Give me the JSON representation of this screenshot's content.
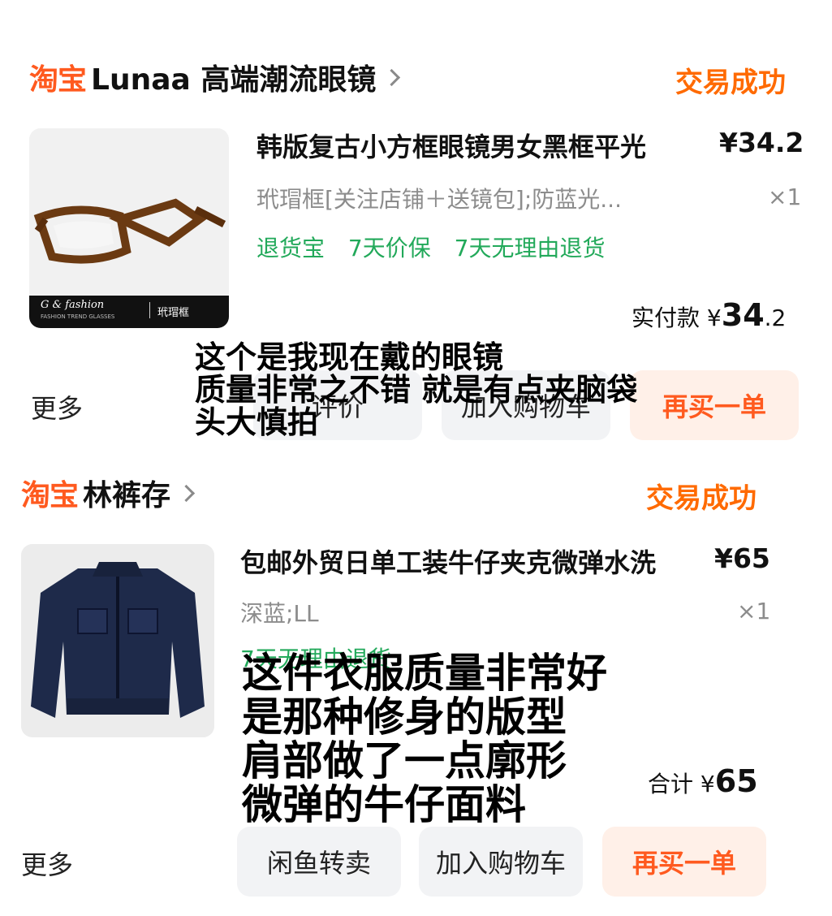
{
  "brand": {
    "logo_text": "淘宝",
    "accent_color": "#ff5a1f",
    "status_color": "#ff6a00",
    "tag_color": "#22a95a"
  },
  "orders": [
    {
      "shop_name": "Lunaa 高端潮流眼镜",
      "status": "交易成功",
      "item": {
        "thumb_icon": "glasses-image",
        "thumb_caption": "G & fashion",
        "thumb_subcaption": "FASHION TREND GLASSES",
        "thumb_tag": "玳瑁框",
        "title": "韩版复古小方框眼镜男女黑框平光",
        "price": "¥34.2",
        "spec": "玳瑁框[关注店铺＋送镜包];防蓝光...",
        "qty": "×1",
        "tags": [
          "退货宝",
          "7天价保",
          "7天无理由退货"
        ]
      },
      "paid_label": "实付款",
      "paid_currency": "¥",
      "paid_int": "34",
      "paid_dec": ".2",
      "more_label": "更多",
      "buttons": [
        "评价",
        "加入购物车",
        "再买一单"
      ]
    },
    {
      "shop_name": "林裤存",
      "status": "交易成功",
      "item": {
        "thumb_icon": "denim-jacket-image",
        "title": "包邮外贸日单工装牛仔夹克微弹水洗",
        "price": "¥65",
        "spec": "深蓝;LL",
        "qty": "×1",
        "tags": [
          "7天无理由退货"
        ]
      },
      "paid_label": "合计",
      "paid_currency": "¥",
      "paid_int": "65",
      "paid_dec": "",
      "more_label": "更多",
      "buttons": [
        "闲鱼转卖",
        "加入购物车",
        "再买一单"
      ]
    }
  ],
  "overlays": {
    "first": [
      "这个是我现在戴的眼镜",
      "质量非常之不错 就是有点夹脑袋",
      "头大慎拍"
    ],
    "second": [
      "这件衣服质量非常好",
      "是那种修身的版型",
      "肩部做了一点廓形",
      "微弹的牛仔面料"
    ]
  }
}
